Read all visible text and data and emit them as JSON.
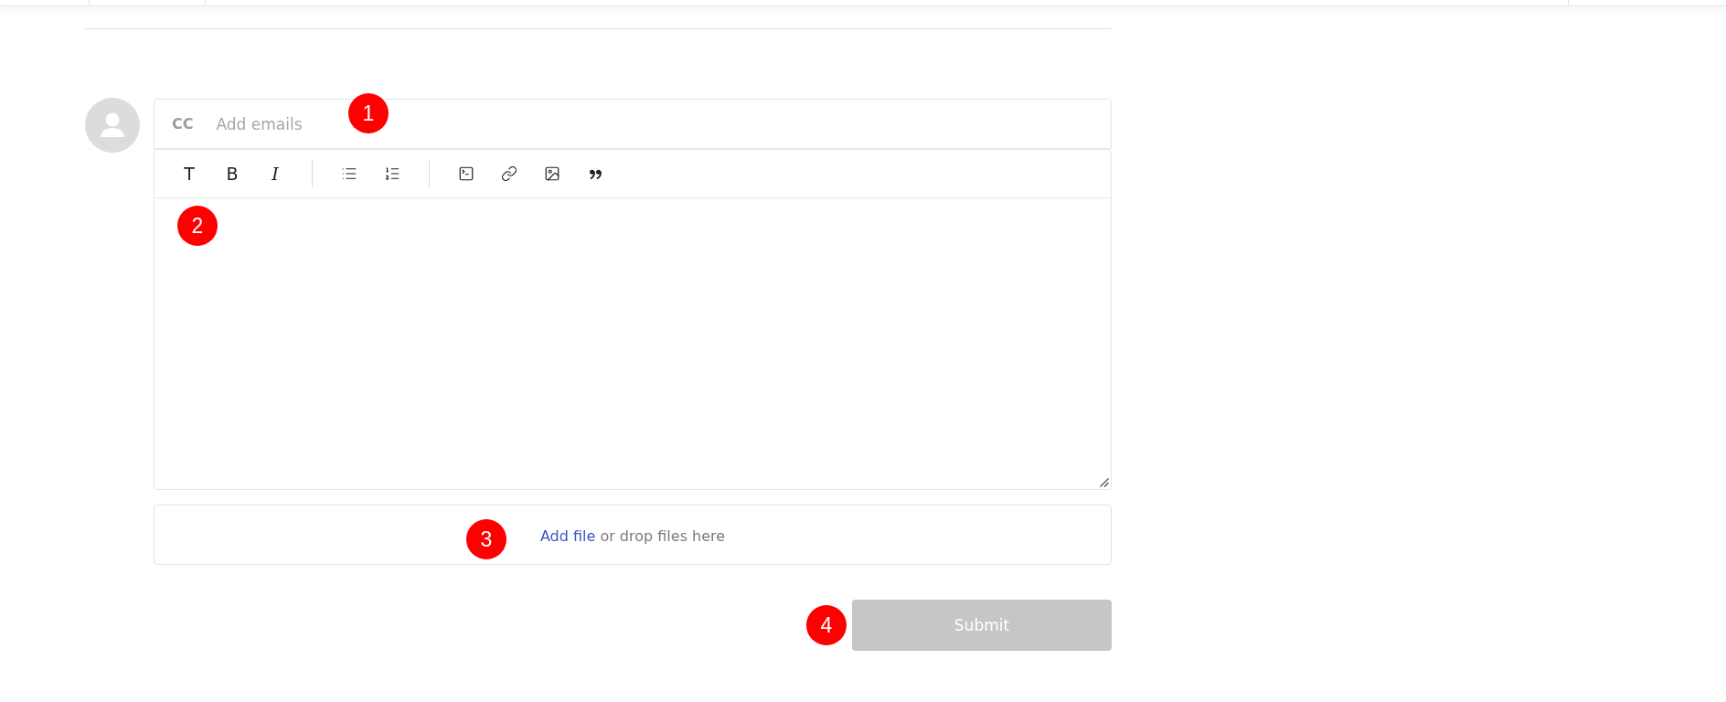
{
  "cc_field": {
    "label": "CC",
    "placeholder": "Add emails",
    "marker": "1"
  },
  "toolbar": {
    "groups": [
      [
        {
          "kind": "heading",
          "label": "T"
        },
        {
          "kind": "bold",
          "label": "B"
        },
        {
          "kind": "italic",
          "label": "I"
        }
      ],
      [
        {
          "kind": "bullet-list"
        },
        {
          "kind": "numbered-list"
        }
      ],
      [
        {
          "kind": "code"
        },
        {
          "kind": "link"
        },
        {
          "kind": "image"
        },
        {
          "kind": "quote"
        }
      ]
    ]
  },
  "editor": {
    "marker": "2"
  },
  "attachments": {
    "link": "Add file",
    "text": "or drop files here",
    "marker": "3"
  },
  "submit": {
    "label": "Submit",
    "disabled": true,
    "marker": "4"
  }
}
